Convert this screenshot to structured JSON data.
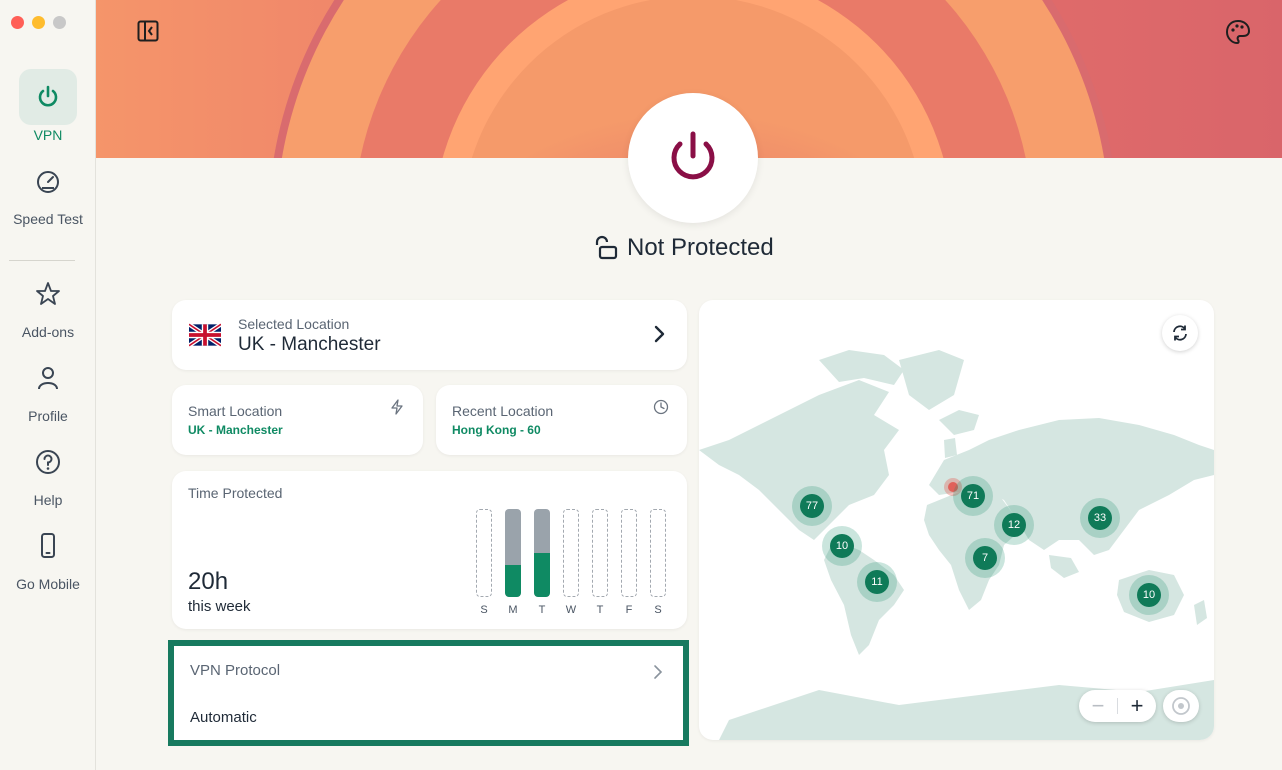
{
  "sidebar": {
    "items": [
      {
        "label": "VPN",
        "icon": "power-icon"
      },
      {
        "label": "Speed Test",
        "icon": "speedometer-icon"
      },
      {
        "label": "Add-ons",
        "icon": "star-icon"
      },
      {
        "label": "Profile",
        "icon": "person-icon"
      },
      {
        "label": "Help",
        "icon": "question-icon"
      },
      {
        "label": "Go Mobile",
        "icon": "phone-icon"
      }
    ]
  },
  "status": {
    "text": "Not Protected",
    "icon": "unlocked-icon"
  },
  "selected_location": {
    "label": "Selected Location",
    "value": "UK - Manchester"
  },
  "smart_location": {
    "label": "Smart Location",
    "value": "UK - Manchester",
    "icon": "bolt-icon"
  },
  "recent_location": {
    "label": "Recent Location",
    "value": "Hong Kong - 60",
    "icon": "clock-icon"
  },
  "time_protected": {
    "label": "Time Protected",
    "hours": "20h",
    "period": "this week",
    "days": [
      "S",
      "M",
      "T",
      "W",
      "T",
      "F",
      "S"
    ],
    "day_fill_fraction": [
      0,
      0.36,
      0.5,
      0,
      0,
      0,
      0
    ]
  },
  "vpn_protocol": {
    "label": "VPN Protocol",
    "value": "Automatic"
  },
  "map": {
    "clusters": [
      "77",
      "10",
      "11",
      "71",
      "12",
      "7",
      "33",
      "10"
    ]
  },
  "colors": {
    "accent": "#0f8a63",
    "power": "#8a0f46",
    "header": "#e77563"
  }
}
